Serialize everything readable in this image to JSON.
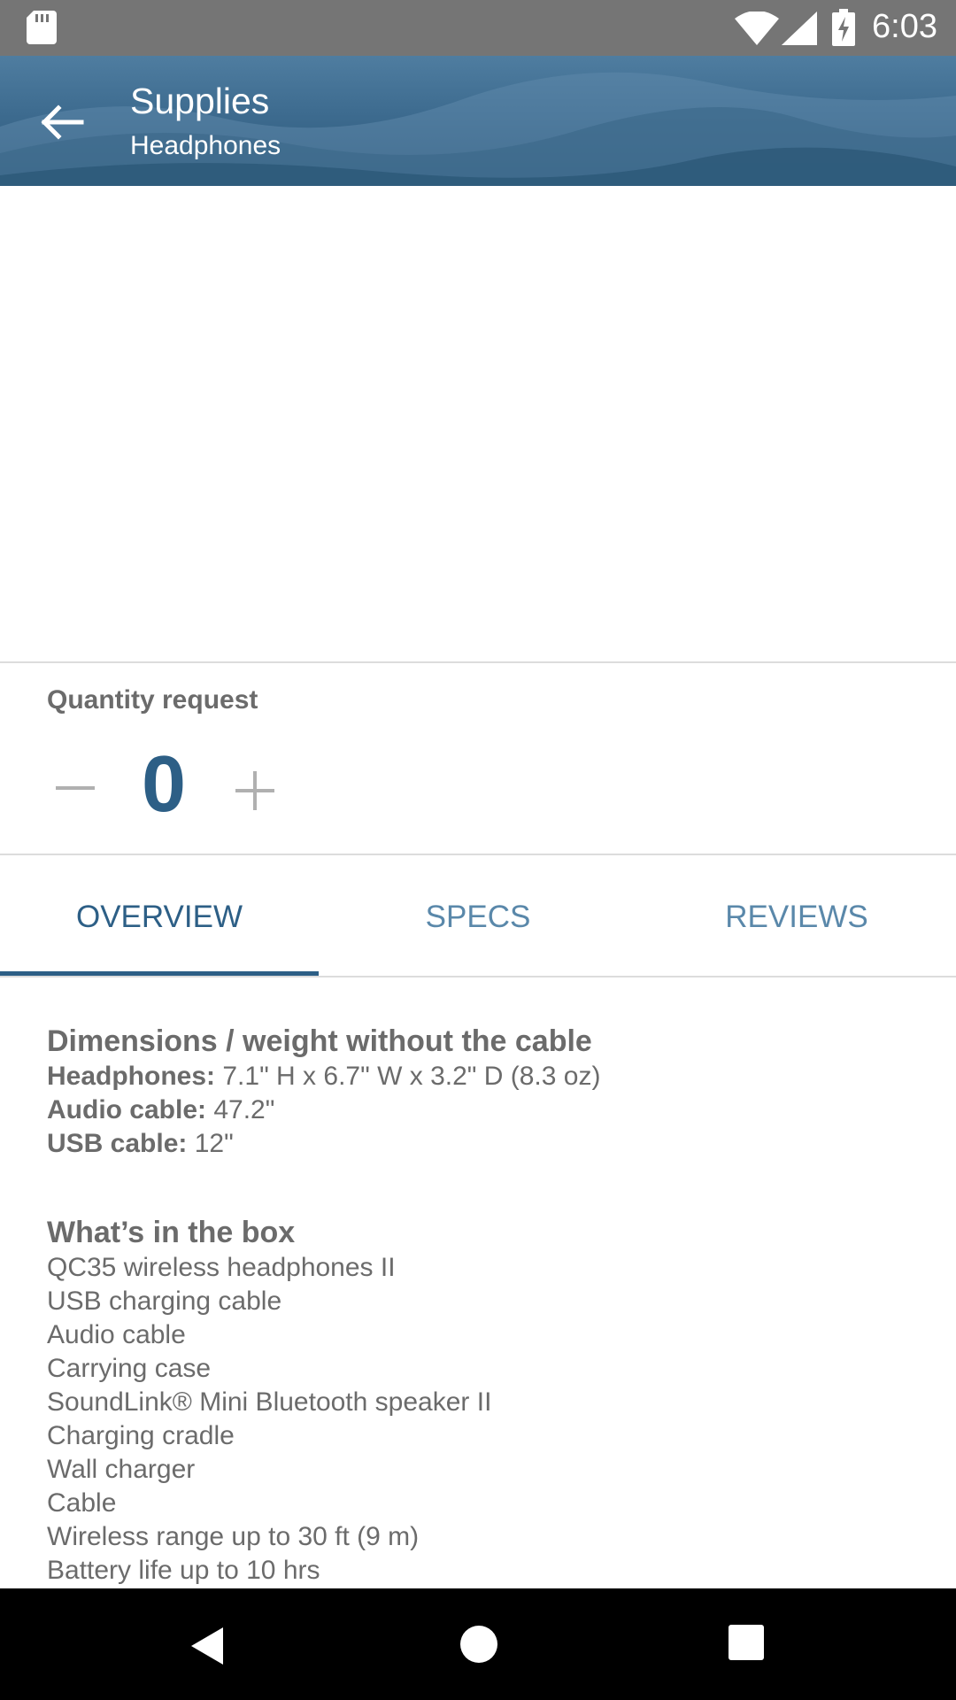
{
  "status_bar": {
    "time": "6:03",
    "icons": [
      "sd-card-icon",
      "wifi-icon",
      "signal-icon",
      "battery-charging-icon"
    ]
  },
  "app_bar": {
    "title": "Supplies",
    "subtitle": "Headphones",
    "back_icon": "arrow-back-icon"
  },
  "quantity": {
    "label": "Quantity request",
    "value": "0",
    "minus_icon": "minus-icon",
    "plus_icon": "plus-icon"
  },
  "tabs": [
    {
      "label": "OVERVIEW",
      "active": true
    },
    {
      "label": "SPECS",
      "active": false
    },
    {
      "label": "REVIEWS",
      "active": false
    }
  ],
  "overview": {
    "dimensions": {
      "title": "Dimensions / weight without the cable",
      "rows": [
        {
          "label": "Headphones:",
          "value": " 7.1\" H x 6.7\" W x 3.2\" D (8.3 oz)"
        },
        {
          "label": "Audio cable:",
          "value": " 47.2\""
        },
        {
          "label": "USB cable:",
          "value": " 12\""
        }
      ]
    },
    "in_box": {
      "title": "What’s in the box",
      "items": [
        "QC35 wireless headphones II",
        "USB charging cable",
        "Audio cable",
        "Carrying case",
        "SoundLink® Mini Bluetooth speaker II",
        "Charging cradle",
        "Wall charger",
        "Cable",
        "Wireless range up to 30 ft (9 m)",
        "Battery life up to 10 hrs"
      ]
    }
  },
  "colors": {
    "accent": "#2d5f86",
    "tab_inactive": "#5a88aa",
    "body_text": "#6b6b6b",
    "status_bar": "#757575"
  }
}
